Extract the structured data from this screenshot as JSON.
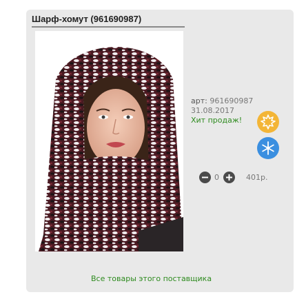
{
  "product": {
    "title": "Шарф-хомут (961690987)",
    "art_label": "арт:",
    "art_number": "961690987",
    "date": "31.08.2017",
    "hit_label": "Хит продаж!",
    "quantity": "0",
    "price": "401р.",
    "supplier_link": "Все товары этого поставщика"
  },
  "icons": {
    "leaf_badge": "leaf-icon",
    "snow_badge": "snowflake-icon",
    "minus": "minus-icon",
    "plus": "plus-icon"
  },
  "colors": {
    "card_bg": "#e9e9e9",
    "link_green": "#2e8b1f",
    "leaf_badge": "#f3b537",
    "snow_badge": "#3b8fe0"
  }
}
